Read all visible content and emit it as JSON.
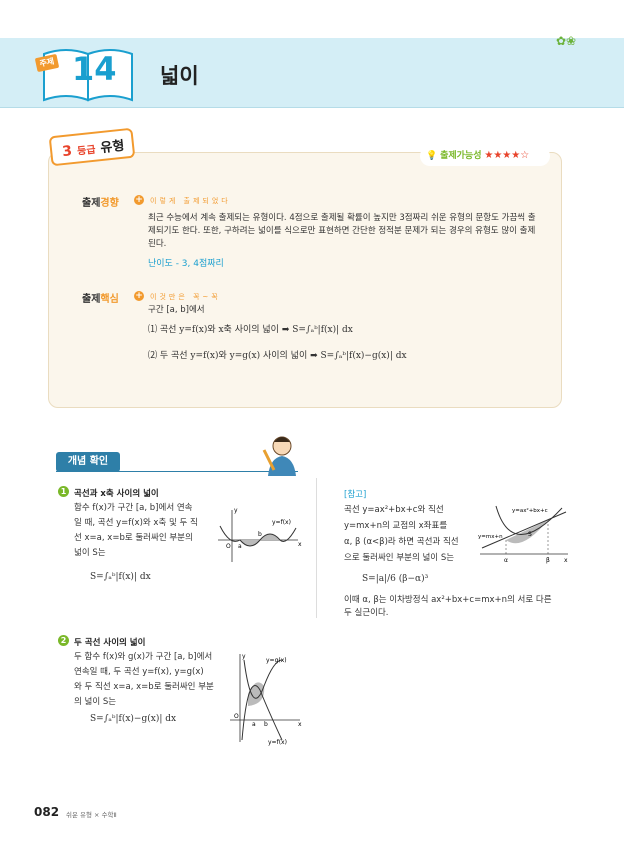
{
  "header": {
    "unit_badge": "주제",
    "unit_number": "14",
    "title": "넓이"
  },
  "grade": {
    "num": "3",
    "text": "등급",
    "label": "유형"
  },
  "frequency": {
    "label": "출제가능성",
    "stars": "★★★★☆"
  },
  "trend": {
    "label_a": "출제",
    "label_b": "경향",
    "sub": "이렇게 출제되었다",
    "lines": [
      "최근 수능에서 계속 출제되는 유형이다. 4점으로 출제될 확률이 높지만 3점짜리 쉬운 유형의 문항도 가끔씩 출",
      "제되기도 한다. 또한, 구하려는 넓이를 식으로만 표현하면 간단한 정적분 문제가 되는 경우의 유형도 많이 출제",
      "된다."
    ],
    "difficulty": "난이도 - 3, 4점짜리"
  },
  "core": {
    "label_a": "출제",
    "label_b": "핵심",
    "sub": "이것만은 꼭~꼭",
    "intro": "구간 [a, b]에서",
    "item1": "⑴ 곡선 y=f(x)와 x축 사이의 넓이 ➡ S=∫ₐᵇ|f(x)| dx",
    "item2": "⑵ 두 곡선 y=f(x)와 y=g(x) 사이의 넓이 ➡ S=∫ₐᵇ|f(x)−g(x)| dx"
  },
  "concept": {
    "label": "개념 확인"
  },
  "sec1": {
    "num": "1",
    "title": "곡선과 x축 사이의 넓이",
    "lines": [
      "함수 f(x)가 구간 [a, b]에서 연속",
      "일 때, 곡선 y=f(x)와 x축 및 두 직",
      "선 x=a, x=b로 둘러싸인 부분의",
      "넓이 S는"
    ],
    "formula": "S=∫ₐᵇ|f(x)| dx",
    "graph": {
      "curve": "y=f(x)",
      "y": "y",
      "x": "x",
      "o": "O",
      "a": "a",
      "b": "b"
    }
  },
  "sec2": {
    "num": "2",
    "title": "두 곡선 사이의 넓이",
    "lines": [
      "두 함수 f(x)와 g(x)가 구간 [a, b]에서",
      "연속일 때, 두 곡선 y=f(x), y=g(x)",
      "와 두 직선 x=a, x=b로 둘러싸인 부분",
      "의 넓이 S는"
    ],
    "formula": "S=∫ₐᵇ|f(x)−g(x)| dx",
    "graph": {
      "g": "y=g(x)",
      "f": "y=f(x)",
      "y": "y",
      "x": "x",
      "o": "O",
      "a": "a",
      "b": "b"
    }
  },
  "note": {
    "ref": "[참고]",
    "lines": [
      "곡선 y=ax²+bx+c와 직선",
      "y=mx+n의 교점의 x좌표를",
      "α, β (α<β)라 하면 곡선과 직선",
      "으로 둘러싸인 부분의 넓이 S는"
    ],
    "formula": "S=|a|/6 (β−α)³",
    "after1": "이때 α, β는 이차방정식 ax²+bx+c=mx+n의 서로 다른",
    "after2": "두 실근이다.",
    "graph": {
      "curve": "y=ax²+bx+c",
      "line": "y=mx+n",
      "s": "S",
      "alpha": "α",
      "beta": "β",
      "x": "x"
    }
  },
  "footer": {
    "page": "082",
    "sub": "쉬운 유형 × 수학Ⅱ"
  }
}
